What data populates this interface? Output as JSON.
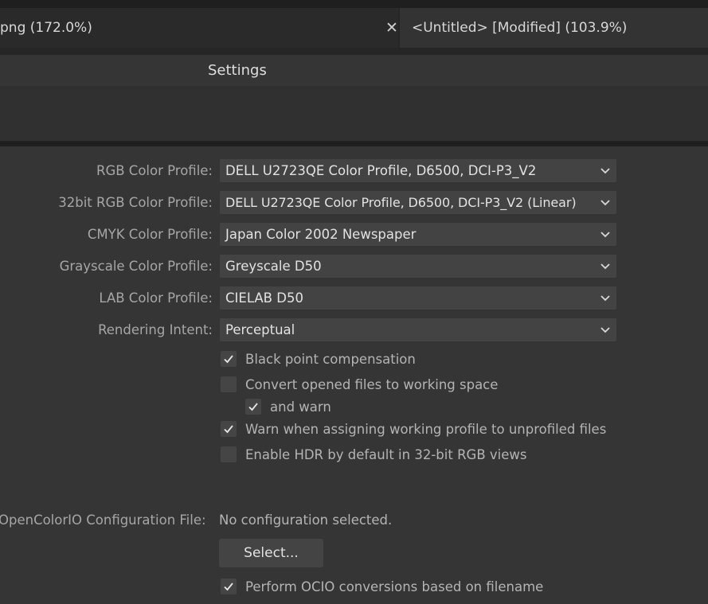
{
  "tabs": [
    {
      "title": "png (172.0%)"
    },
    {
      "title": "<Untitled> [Modified] (103.9%)"
    }
  ],
  "panel": {
    "title": "Settings"
  },
  "color_profiles": [
    {
      "label": "RGB Color Profile:",
      "value": "DELL U2723QE Color Profile, D6500, DCI-P3_V2"
    },
    {
      "label": "32bit RGB Color Profile:",
      "value": "DELL U2723QE Color Profile, D6500, DCI-P3_V2 (Linear)"
    },
    {
      "label": "CMYK Color Profile:",
      "value": "Japan Color 2002 Newspaper"
    },
    {
      "label": "Grayscale Color Profile:",
      "value": "Greyscale D50"
    },
    {
      "label": "LAB Color Profile:",
      "value": "CIELAB D50"
    },
    {
      "label": "Rendering Intent:",
      "value": "Perceptual"
    }
  ],
  "options": [
    {
      "label": "Black point compensation",
      "checked": true
    },
    {
      "label": "Convert opened files to working space",
      "checked": false
    },
    {
      "label": "and warn",
      "checked": true
    },
    {
      "label": "Warn when assigning working profile to unprofiled files",
      "checked": true
    },
    {
      "label": "Enable HDR by default in 32-bit RGB views",
      "checked": false
    }
  ],
  "ocio": {
    "label": "OpenColorIO Configuration File:",
    "value": "No configuration selected.",
    "select_button": "Select...",
    "perform_label": "Perform OCIO conversions based on filename",
    "perform_checked": true
  },
  "icons": {
    "close": "close-icon",
    "dropdown": "chevron-down-icon",
    "check": "checkmark-icon"
  }
}
